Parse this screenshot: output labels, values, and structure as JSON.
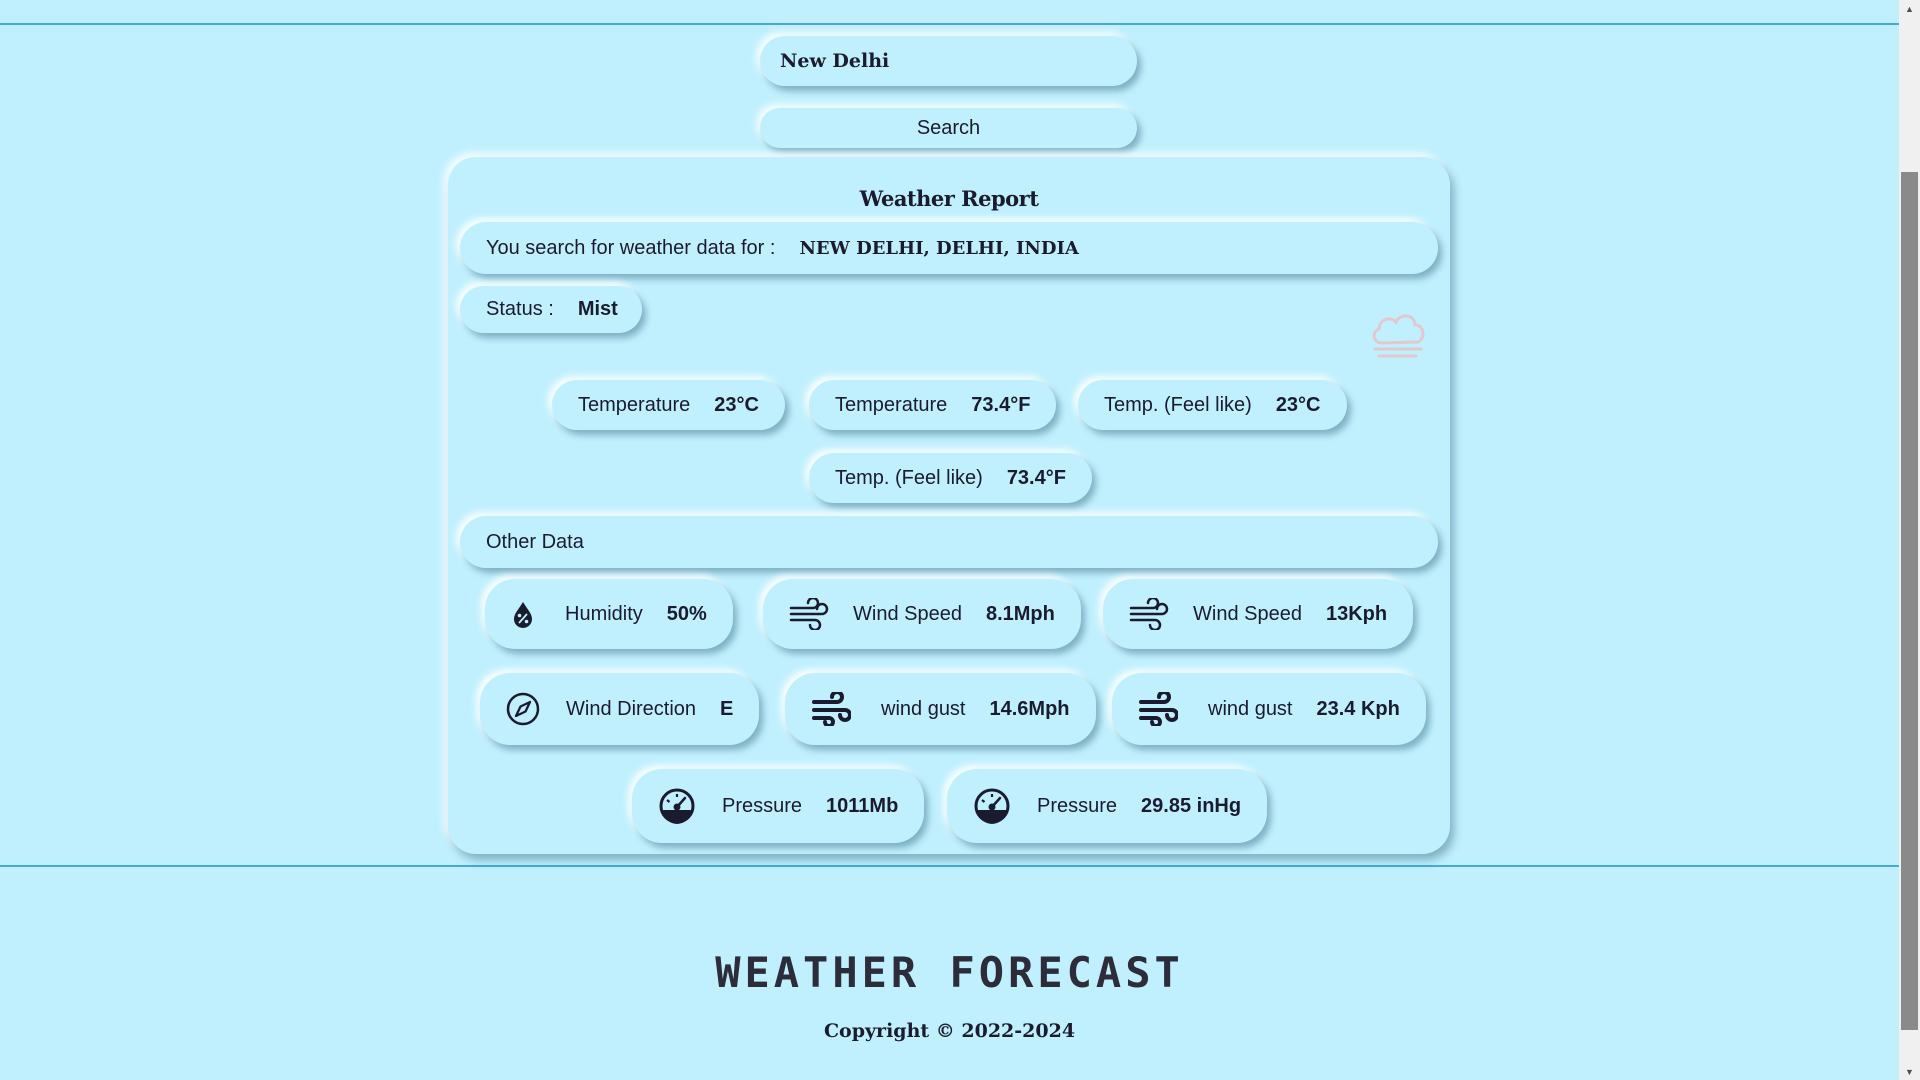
{
  "search": {
    "value": "New Delhi",
    "button_label": "Search"
  },
  "report": {
    "title": "Weather Report",
    "search_label": "You search for weather data for :",
    "location": "NEW DELHI, DELHI, INDIA",
    "status_label": "Status :",
    "status_value": "Mist",
    "status_icon": "cloud-mist-icon",
    "temps": [
      {
        "label": "Temperature",
        "value": "23°C"
      },
      {
        "label": "Temperature",
        "value": "73.4°F"
      },
      {
        "label": "Temp. (Feel like)",
        "value": "23°C"
      },
      {
        "label": "Temp. (Feel like)",
        "value": "73.4°F"
      }
    ],
    "other_data_label": "Other Data",
    "metrics": [
      {
        "icon": "humidity-icon",
        "label": "Humidity",
        "value": "50%"
      },
      {
        "icon": "wind-icon",
        "label": "Wind Speed",
        "value": "8.1Mph"
      },
      {
        "icon": "wind-icon",
        "label": "Wind Speed",
        "value": "13Kph"
      },
      {
        "icon": "compass-icon",
        "label": "Wind Direction",
        "value": "E"
      },
      {
        "icon": "wind-gust-icon",
        "label": "wind gust",
        "value": "14.6Mph"
      },
      {
        "icon": "wind-gust-icon",
        "label": "wind gust",
        "value": "23.4 Kph"
      },
      {
        "icon": "gauge-icon",
        "label": "Pressure",
        "value": "1011Mb"
      },
      {
        "icon": "gauge-icon",
        "label": "Pressure",
        "value": "29.85 inHg"
      }
    ]
  },
  "footer": {
    "title": "WEATHER FORECAST",
    "copyright": "Copyright © 2022-2024"
  },
  "colors": {
    "background": "#c0f0fe",
    "divider": "#45a8e0",
    "text": "#1b1b2f"
  }
}
